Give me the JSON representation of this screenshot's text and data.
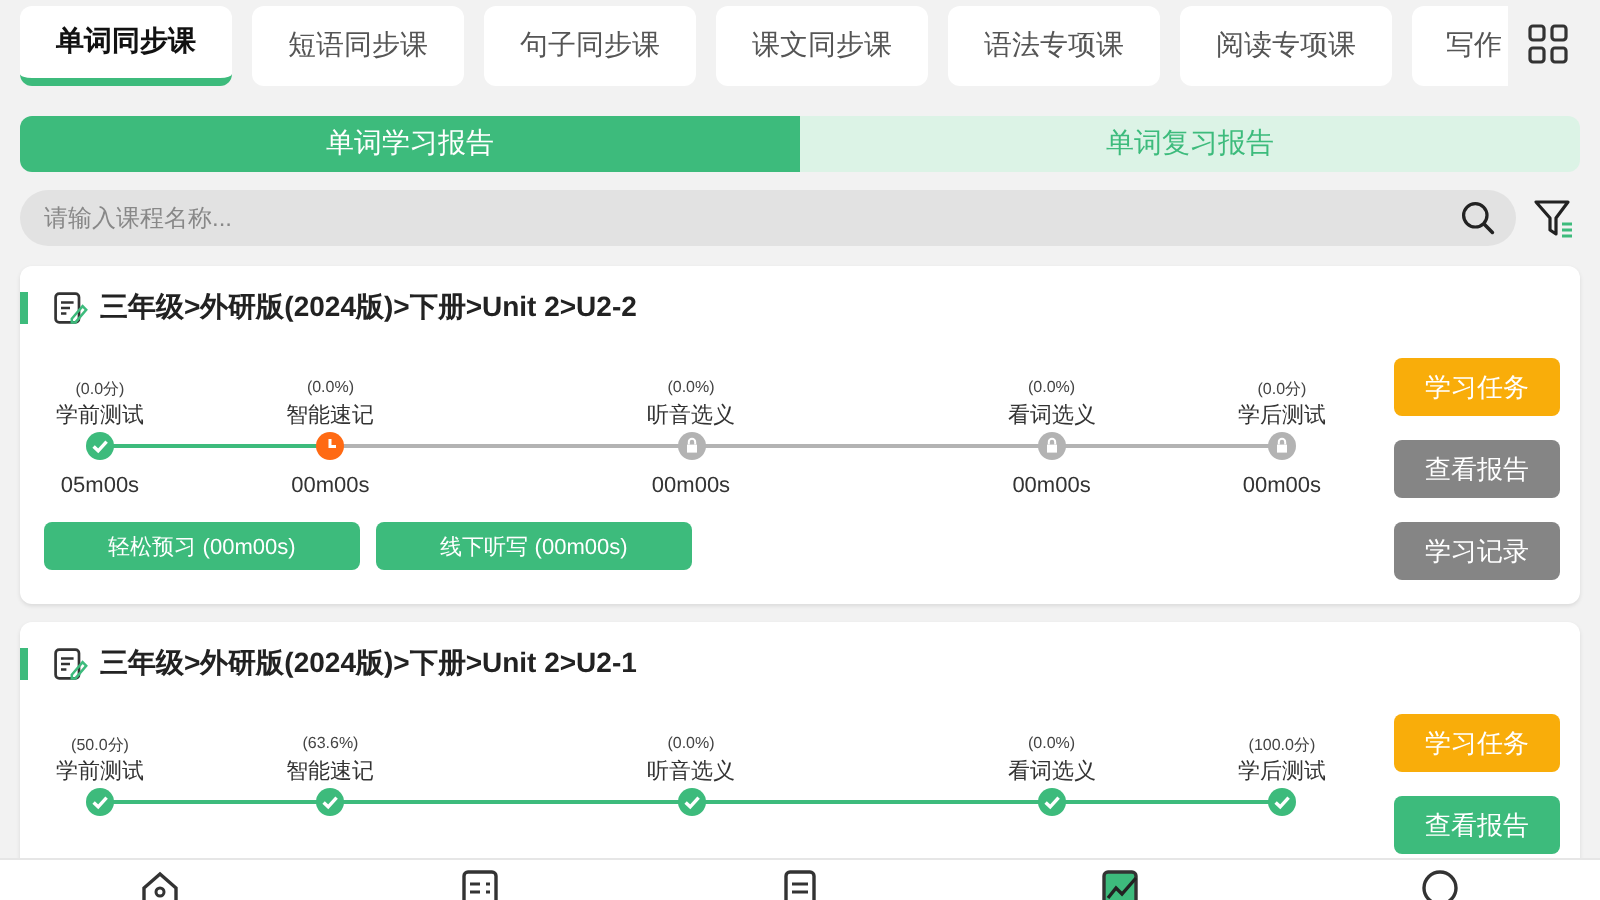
{
  "tabs": [
    {
      "label": "单词同步课",
      "selected": true
    },
    {
      "label": "短语同步课",
      "selected": false
    },
    {
      "label": "句子同步课",
      "selected": false
    },
    {
      "label": "课文同步课",
      "selected": false
    },
    {
      "label": "语法专项课",
      "selected": false
    },
    {
      "label": "阅读专项课",
      "selected": false
    },
    {
      "label": "写作",
      "selected": false
    }
  ],
  "report_tabs": [
    {
      "label": "单词学习报告",
      "selected": true
    },
    {
      "label": "单词复习报告",
      "selected": false
    }
  ],
  "search": {
    "placeholder": "请输入课程名称..."
  },
  "courses": [
    {
      "title": "三年级>外研版(2024版)>下册>Unit 2>U2-2",
      "steps": [
        {
          "score": "(0.0分)",
          "label": "学前测试",
          "time": "05m00s",
          "kind": "done"
        },
        {
          "score": "(0.0%)",
          "label": "智能速记",
          "time": "00m00s",
          "kind": "current"
        },
        {
          "score": "(0.0%)",
          "label": "听音选义",
          "time": "00m00s",
          "kind": "locked"
        },
        {
          "score": "(0.0%)",
          "label": "看词选义",
          "time": "00m00s",
          "kind": "locked"
        },
        {
          "score": "(0.0分)",
          "label": "学后测试",
          "time": "00m00s",
          "kind": "locked"
        }
      ],
      "extras": [
        "轻松预习 (00m00s)",
        "线下听写 (00m00s)"
      ],
      "buttons": [
        {
          "label": "学习任务",
          "kind": "task"
        },
        {
          "label": "查看报告",
          "kind": "action",
          "enabled": false
        },
        {
          "label": "学习记录",
          "kind": "action",
          "enabled": false
        }
      ]
    },
    {
      "title": "三年级>外研版(2024版)>下册>Unit 2>U2-1",
      "steps": [
        {
          "score": "(50.0分)",
          "label": "学前测试",
          "kind": "done"
        },
        {
          "score": "(63.6%)",
          "label": "智能速记",
          "kind": "done"
        },
        {
          "score": "(0.0%)",
          "label": "听音选义",
          "kind": "done"
        },
        {
          "score": "(0.0%)",
          "label": "看词选义",
          "kind": "done"
        },
        {
          "score": "(100.0分)",
          "label": "学后测试",
          "kind": "done"
        }
      ],
      "buttons": [
        {
          "label": "学习任务",
          "kind": "task"
        },
        {
          "label": "查看报告",
          "kind": "action",
          "enabled": true
        }
      ]
    }
  ],
  "bottom_nav": [
    {
      "selected": false
    },
    {
      "selected": false
    },
    {
      "selected": false
    },
    {
      "selected": true
    },
    {
      "selected": false
    }
  ]
}
